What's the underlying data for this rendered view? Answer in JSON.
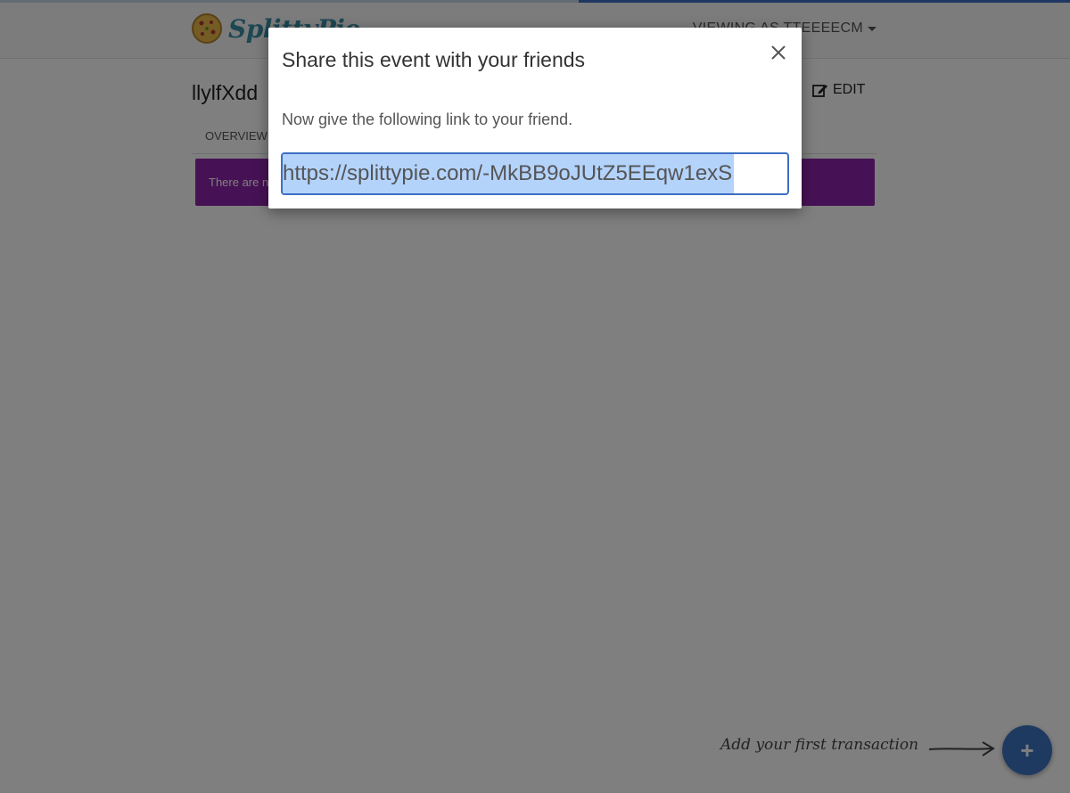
{
  "brand": {
    "name": "SplittyPie"
  },
  "navbar": {
    "user_menu": "VIEWING AS TTEEEECM"
  },
  "event": {
    "title": "llylfXdd",
    "edit_label": "EDIT",
    "tabs": [
      {
        "label": "OVERVIEW"
      }
    ],
    "alert_text": "There are no"
  },
  "fab": {
    "hint": "Add your first transaction",
    "label": "+"
  },
  "modal": {
    "title": "Share this event with your friends",
    "message": "Now give the following link to your friend.",
    "link": "https://splittypie.com/-MkBB9oJUtZ5EEqw1exS"
  },
  "colors": {
    "accent": "#3d6fc4",
    "alert": "#8e24aa",
    "fab": "#3f75c2",
    "selection": "#b3d3fb"
  }
}
